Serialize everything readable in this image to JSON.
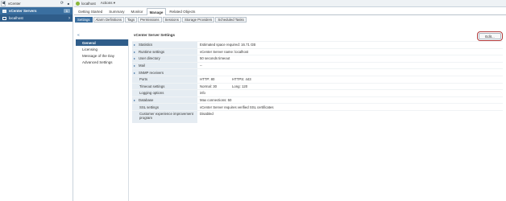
{
  "navigator": {
    "back_label": "◀",
    "title": "vCenter",
    "header_label": "vCenter Servers",
    "header_count": "1",
    "item_label": "localhost"
  },
  "object": {
    "title": "localhost",
    "actions_label": "Actions ▾"
  },
  "tabs": [
    "Getting Started",
    "Summary",
    "Monitor",
    "Manage",
    "Related Objects"
  ],
  "active_tab": "Manage",
  "subtabs": [
    "Settings",
    "Alarm Definitions",
    "Tags",
    "Permissions",
    "Sessions",
    "Storage Providers",
    "Scheduled Tasks"
  ],
  "active_subtab": "Settings",
  "left_list": [
    "General",
    "Licensing",
    "Message of the Day",
    "Advanced Settings"
  ],
  "section_title": "vCenter Server Settings",
  "edit_label": "Edit...",
  "settings": [
    {
      "label": "Statistics",
      "value": "Estimated space required: 16.71 GB",
      "expander": "▸"
    },
    {
      "label": "Runtime settings",
      "value": "vCenter Server name: localhost",
      "expander": "▸"
    },
    {
      "label": "User directory",
      "value": "50 seconds timeout",
      "expander": "▸"
    },
    {
      "label": "Mail",
      "value": "--",
      "expander": "▸"
    },
    {
      "label": "SNMP receivers",
      "value": "",
      "expander": "▸"
    },
    {
      "label": "Ports",
      "value": "HTTP: 80",
      "value2": "HTTPS: 443",
      "indent": true
    },
    {
      "label": "Timeout settings",
      "value": "Normal: 30",
      "value2": "Long: 120",
      "indent": true
    },
    {
      "label": "Logging options",
      "value": "info",
      "indent": true
    },
    {
      "label": "Database",
      "value": "Max connections: 50",
      "expander": "▸"
    },
    {
      "label": "SSL settings",
      "value": "vCenter Server requires verified SSL certificates",
      "indent": true
    },
    {
      "label": "Customer experience improvement program",
      "value": "Disabled",
      "indent": true,
      "tall": true
    }
  ]
}
